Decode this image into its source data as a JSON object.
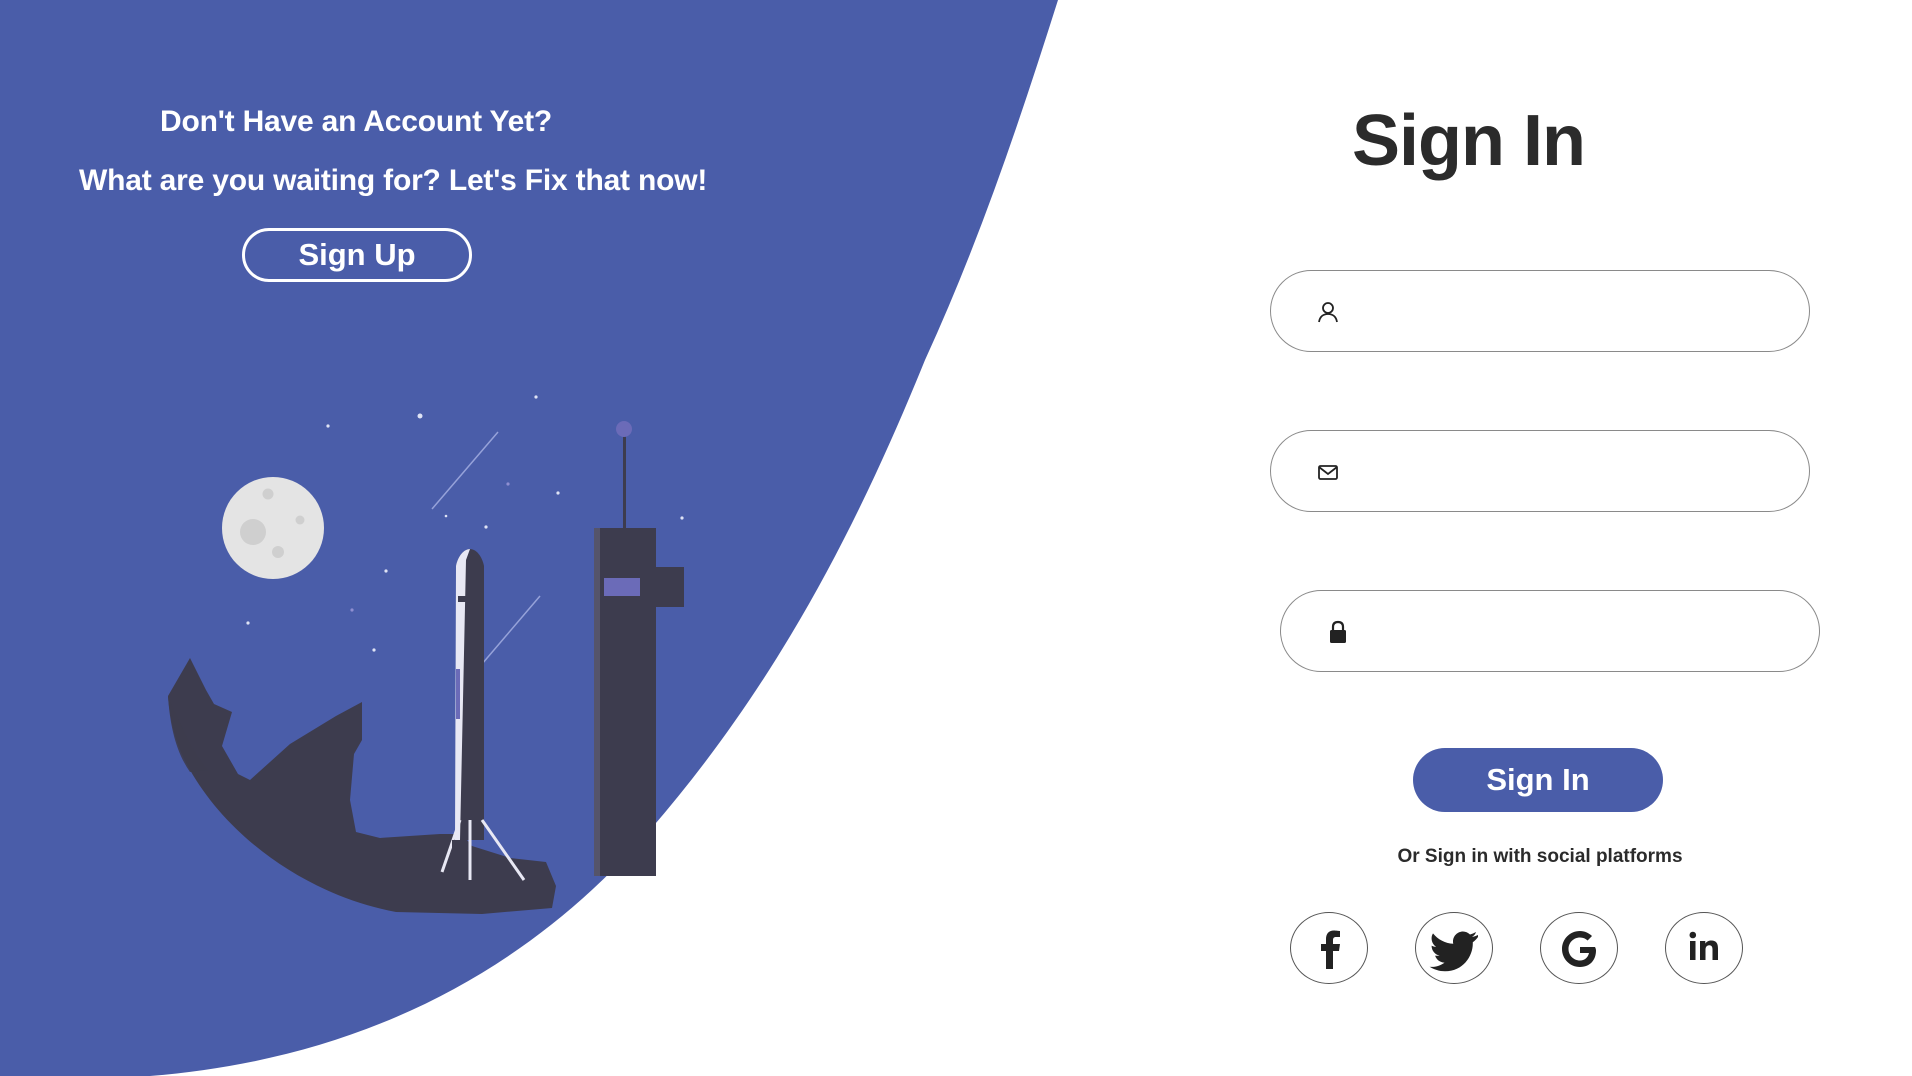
{
  "colors": {
    "brand_blue": "#4a5da9",
    "illustration_dark": "#3d3c4e",
    "text_dark": "#2b2b2b",
    "moon": "#e4e4e4"
  },
  "promo": {
    "line1": "Don't Have an Account Yet?",
    "line2": "What are you waiting for? Let's Fix that now!",
    "signup_label": "Sign Up"
  },
  "form": {
    "title": "Sign In",
    "username": {
      "icon": "user-icon",
      "value": "",
      "placeholder": ""
    },
    "email": {
      "icon": "mail-icon",
      "value": "",
      "placeholder": ""
    },
    "password": {
      "icon": "lock-icon",
      "value": "",
      "placeholder": ""
    },
    "submit_label": "Sign In",
    "social_text": "Or Sign in with social platforms",
    "social": [
      {
        "name": "facebook",
        "icon": "facebook-icon"
      },
      {
        "name": "twitter",
        "icon": "twitter-icon"
      },
      {
        "name": "google",
        "icon": "google-icon"
      },
      {
        "name": "linkedin",
        "icon": "linkedin-icon"
      }
    ]
  },
  "illustration": {
    "content": "rocket-launch-icon"
  }
}
